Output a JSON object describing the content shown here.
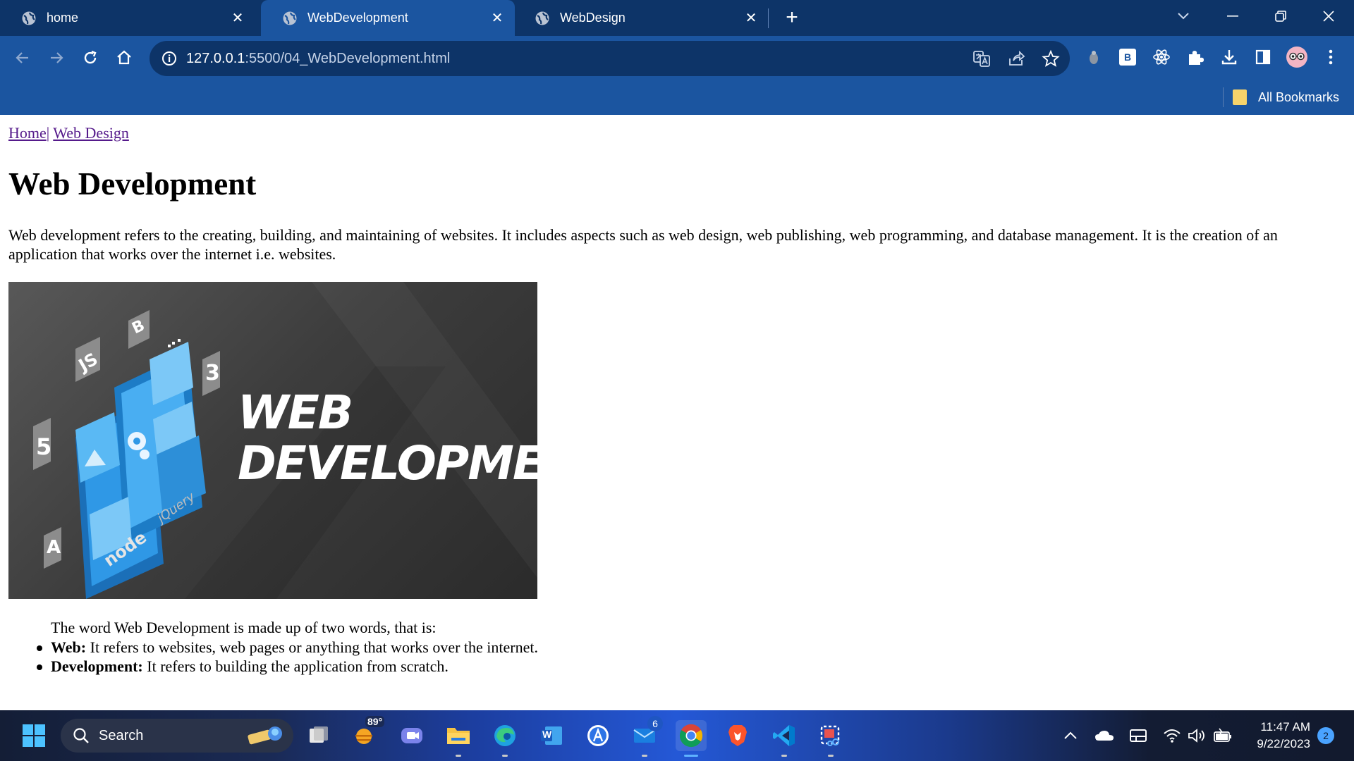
{
  "browser": {
    "tabs": [
      {
        "title": "home",
        "active": false
      },
      {
        "title": "WebDevelopment",
        "active": true
      },
      {
        "title": "WebDesign",
        "active": false
      }
    ],
    "address": {
      "host": "127.0.0.1",
      "rest": ":5500/04_WebDevelopment.html"
    },
    "bookmarks_bar": {
      "label": "All Bookmarks"
    },
    "extension_b_label": "B",
    "colors": {
      "chrome": "#1b55a0",
      "tabstrip": "#0d3468"
    }
  },
  "page": {
    "breadcrumbs": {
      "home": "Home",
      "separator": "|",
      "design": "Web Design"
    },
    "heading": "Web Development",
    "intro": "Web development refers to the creating, building, and maintaining of websites. It includes aspects such as web design, web publishing, web programming, and database management. It is the creation of an application that works over the internet i.e. websites.",
    "image": {
      "title_line1": "WEB",
      "title_line2": "DEVELOPMENT",
      "badges": {
        "js": "JS",
        "bootstrap": "B",
        "css": "3",
        "html": "5",
        "angular": "A",
        "node": "node",
        "jquery": "jQuery"
      }
    },
    "words_intro": "The word Web Development is made up of two words, that is:",
    "words": [
      {
        "term": "Web:",
        "definition": " It refers to websites, web pages or anything that works over the internet."
      },
      {
        "term": "Development:",
        "definition": " It refers to building the application from scratch."
      }
    ]
  },
  "taskbar": {
    "search_label": "Search",
    "weather_temp": "89°",
    "mail_badge": "6",
    "word_label": "W",
    "time": "11:47 AM",
    "date": "9/22/2023",
    "notification_count": "2"
  }
}
